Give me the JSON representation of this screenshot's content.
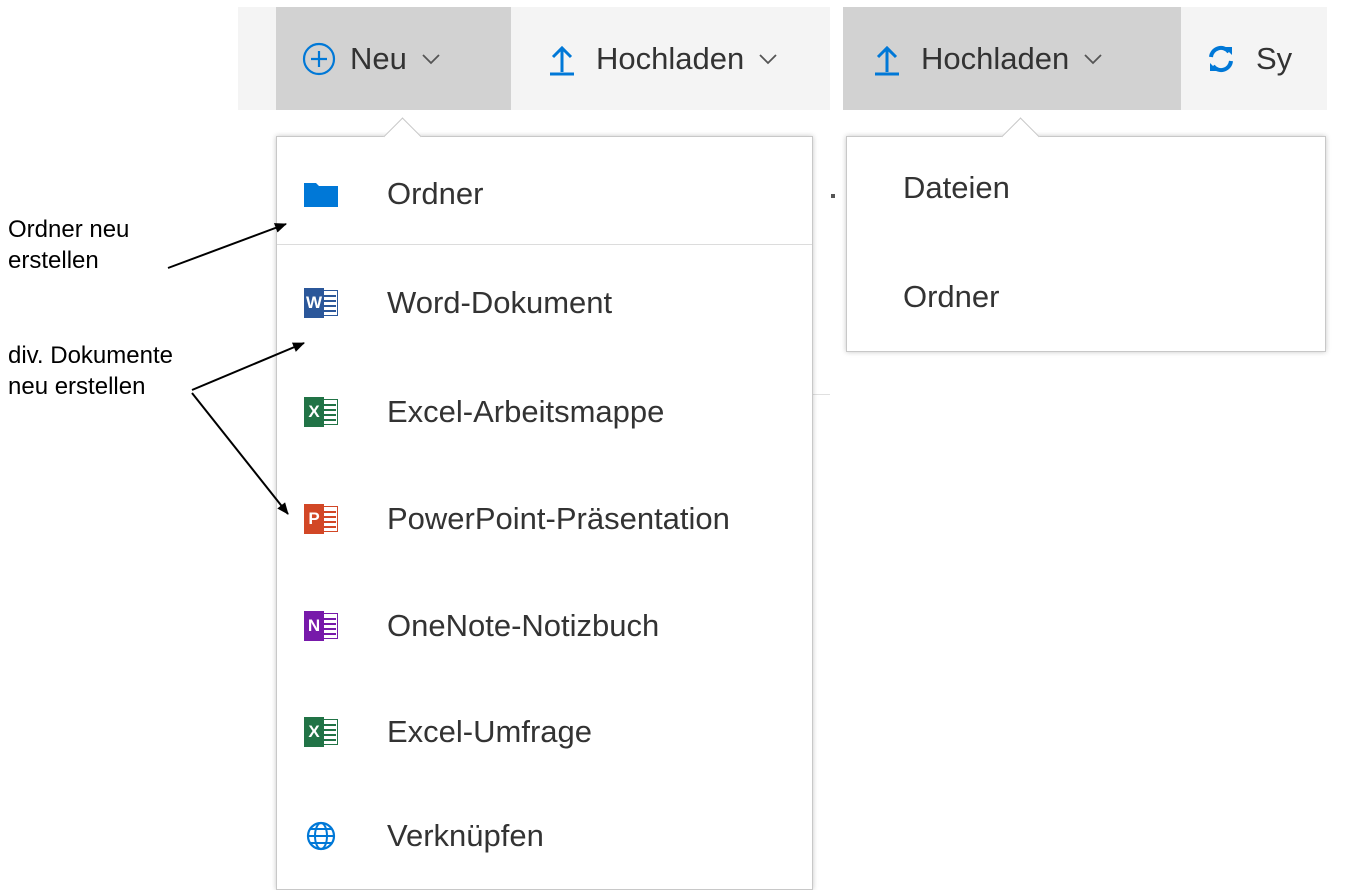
{
  "left_toolbar": {
    "new_label": "Neu",
    "upload_label": "Hochladen"
  },
  "new_menu": {
    "items": [
      {
        "label": "Ordner",
        "icon": "folder-icon"
      },
      {
        "label": "Word-Dokument",
        "icon": "word-icon",
        "badge": "W"
      },
      {
        "label": "Excel-Arbeitsmappe",
        "icon": "excel-icon",
        "badge": "X"
      },
      {
        "label": "PowerPoint-Präsentation",
        "icon": "powerpoint-icon",
        "badge": "P"
      },
      {
        "label": "OneNote-Notizbuch",
        "icon": "onenote-icon",
        "badge": "N"
      },
      {
        "label": "Excel-Umfrage",
        "icon": "excel-icon",
        "badge": "X"
      },
      {
        "label": "Verknüpfen",
        "icon": "globe-icon"
      }
    ]
  },
  "right_toolbar": {
    "upload_label": "Hochladen",
    "sync_label": "Sy"
  },
  "upload_menu": {
    "items": [
      {
        "label": "Dateien"
      },
      {
        "label": "Ordner"
      }
    ]
  },
  "annotations": {
    "folder_note_line1": "Ordner neu",
    "folder_note_line2": "erstellen",
    "docs_note_line1": "div. Dokumente",
    "docs_note_line2": "neu erstellen"
  },
  "colors": {
    "accent_blue": "#0078d7",
    "word": "#2b579a",
    "excel": "#217346",
    "powerpoint": "#d24726",
    "onenote": "#7719aa",
    "toolbar_bg": "#f4f4f4",
    "active_bg": "#d2d2d2"
  }
}
